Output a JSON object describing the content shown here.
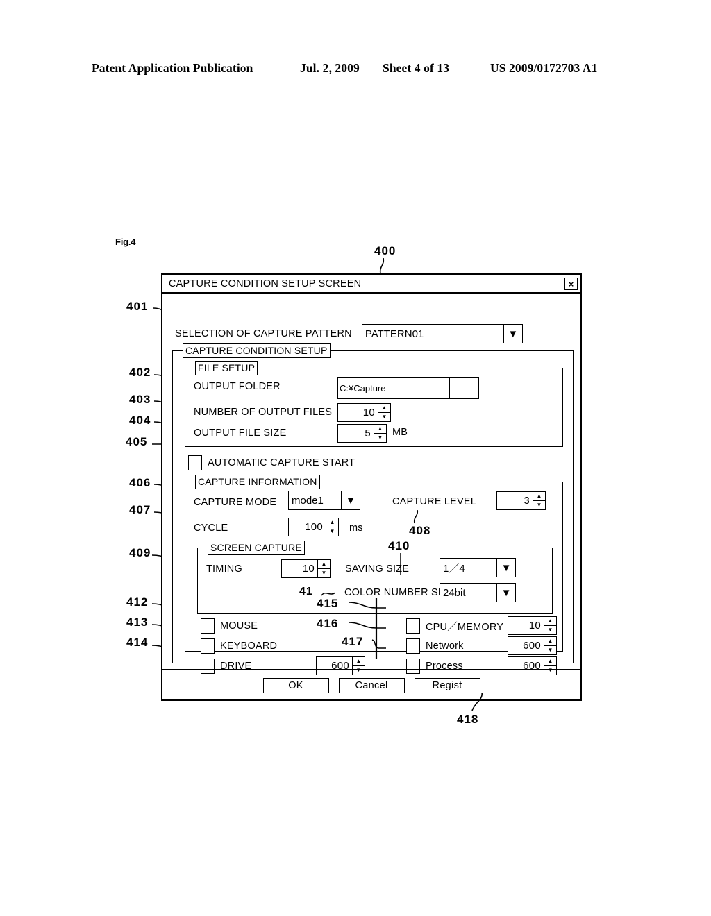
{
  "patent_header": {
    "publication": "Patent Application Publication",
    "date": "Jul. 2, 2009",
    "sheet": "Sheet 4 of 13",
    "number": "US 2009/0172703 A1"
  },
  "figure": {
    "label": "Fig.4",
    "dialog_ref": "400"
  },
  "dialog": {
    "title": "CAPTURE CONDITION SETUP SCREEN",
    "close_icon": "×"
  },
  "pattern_selection": {
    "ref": "401",
    "label": "SELECTION OF CAPTURE PATTERN",
    "value": "PATTERN01",
    "arrow_icon": "▼"
  },
  "capture_condition_setup": {
    "legend": "CAPTURE CONDITION SETUP"
  },
  "file_setup": {
    "legend": "FILE SETUP",
    "output_folder": {
      "ref": "402",
      "label": "OUTPUT FOLDER",
      "value": "C:¥Capture",
      "browse_label": ""
    },
    "number_of_output_files": {
      "ref": "403",
      "label": "NUMBER OF OUTPUT FILES",
      "value": "10"
    },
    "output_file_size": {
      "ref": "404",
      "label": "OUTPUT FILE SIZE",
      "value": "5",
      "unit": "MB"
    }
  },
  "automatic_capture_start": {
    "ref": "405",
    "label": "AUTOMATIC CAPTURE START",
    "checked": false
  },
  "capture_information": {
    "legend": "CAPTURE INFORMATION",
    "capture_mode": {
      "ref": "406",
      "label": "CAPTURE MODE",
      "value": "mode1",
      "arrow_icon": "▼"
    },
    "capture_level": {
      "ref": "408",
      "label": "CAPTURE LEVEL",
      "value": "3"
    },
    "cycle": {
      "ref": "407",
      "label": "CYCLE",
      "value": "100",
      "unit": "ms"
    }
  },
  "screen_capture": {
    "legend": "SCREEN CAPTURE",
    "timing": {
      "ref": "409",
      "label": "TIMING",
      "value": "10"
    },
    "saving_size": {
      "ref": "410",
      "label": "SAVING SIZE",
      "value": "1／4",
      "arrow_icon": "▼"
    },
    "color_number_setup": {
      "ref": "41",
      "label": "COLOR NUMBER SETUP",
      "value": "24bit",
      "arrow_icon": "▼"
    }
  },
  "capture_targets": {
    "left": [
      {
        "ref": "412",
        "label": "MOUSE",
        "checked": false
      },
      {
        "ref": "413",
        "label": "KEYBOARD",
        "checked": false
      },
      {
        "ref": "414",
        "label": "DRIVE",
        "checked": false,
        "value": "600"
      }
    ],
    "right": [
      {
        "ref": "415",
        "label": "CPU／MEMORY",
        "checked": false,
        "value": "10"
      },
      {
        "ref": "416",
        "label": "Network",
        "checked": false,
        "value": "600"
      },
      {
        "ref": "417",
        "label": "Process",
        "checked": false,
        "value": "600"
      }
    ]
  },
  "buttons": {
    "ok": "OK",
    "cancel": "Cancel",
    "regist": "Regist",
    "regist_ref": "418"
  },
  "spinner_icons": {
    "up": "▲",
    "down": "▼"
  }
}
